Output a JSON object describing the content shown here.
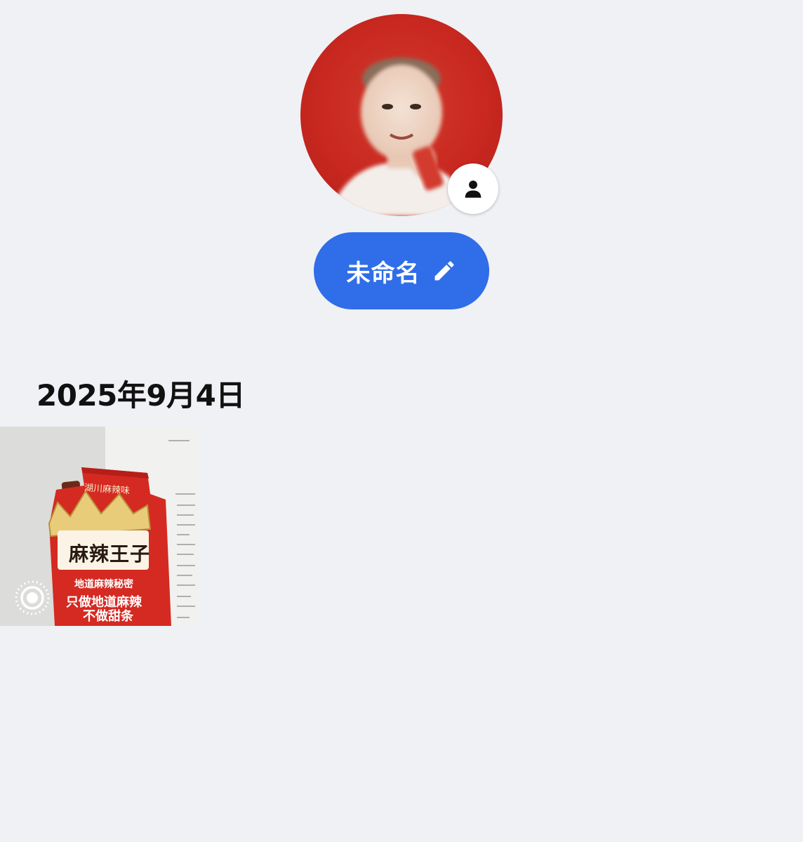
{
  "profile": {
    "display_name": "未命名",
    "avatar_icon": "person-silhouette",
    "edit_icon": "pencil-icon"
  },
  "album": {
    "date": "2025年9月4日",
    "photo": {
      "package_title": "麻辣王子",
      "package_tagline_1": "只做地道麻辣",
      "package_tagline_2": "不做甜条",
      "package_subline": "地道麻辣秘密",
      "package_top": "湖川麻辣味",
      "live_indicator": "live-photo-icon"
    }
  },
  "colors": {
    "background": "#eff1f4",
    "accent_blue": "#2f6ee8",
    "avatar_red": "#c8281f",
    "package_red": "#d42a22"
  }
}
